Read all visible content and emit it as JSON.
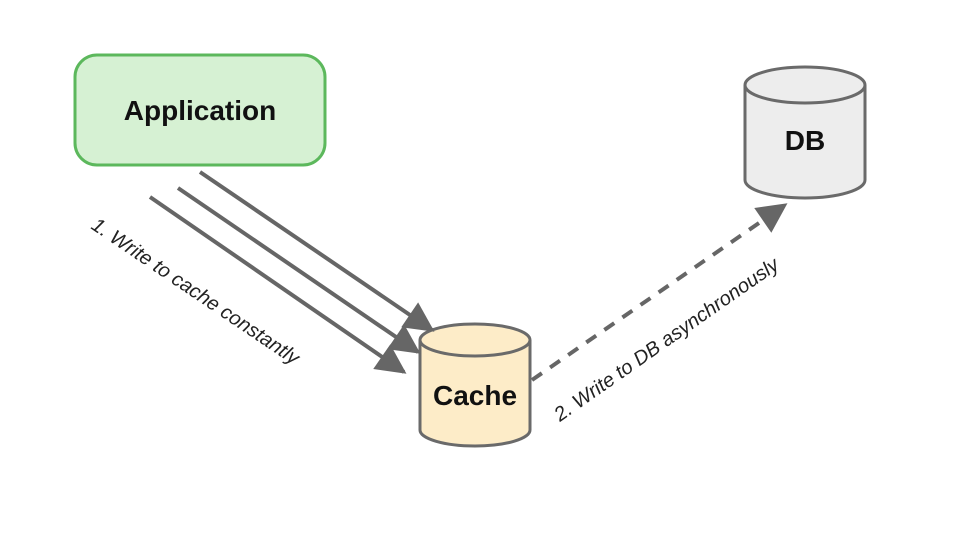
{
  "diagram": {
    "nodes": {
      "application": {
        "label": "Application",
        "shape": "rounded-rect",
        "fill": "#d6f1d3",
        "stroke": "#5cb85c"
      },
      "cache": {
        "label": "Cache",
        "shape": "cylinder",
        "fill": "#fdecc8",
        "stroke": "#6a6a6a"
      },
      "db": {
        "label": "DB",
        "shape": "cylinder",
        "fill": "#ededed",
        "stroke": "#6a6a6a"
      }
    },
    "edges": {
      "app_to_cache": {
        "label": "1. Write to cache constantly",
        "style": "solid",
        "multiplicity": 3,
        "arrow": "end"
      },
      "cache_to_db": {
        "label": "2. Write to DB asynchronously",
        "style": "dashed",
        "multiplicity": 1,
        "arrow": "end"
      }
    }
  }
}
